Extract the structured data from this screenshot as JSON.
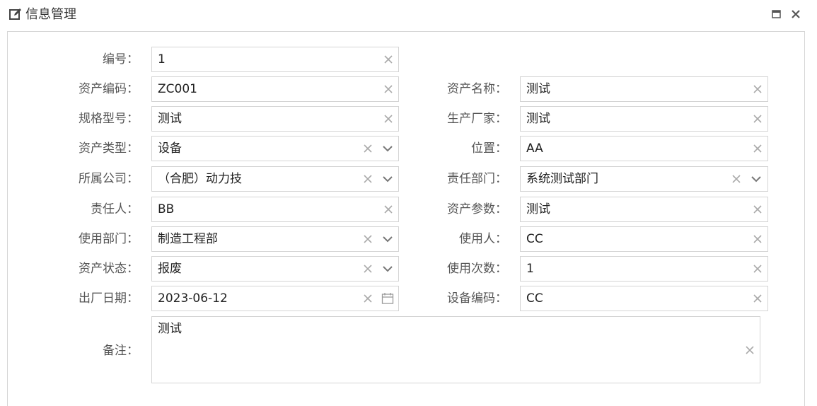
{
  "window": {
    "title": "信息管理",
    "edit_icon": "edit-icon",
    "maximize_icon": "maximize-icon",
    "close_icon": "close-icon"
  },
  "form": {
    "bianhao": {
      "label": "编号：",
      "value": "1"
    },
    "zcbm": {
      "label": "资产编码：",
      "value": "ZC001"
    },
    "zcmc": {
      "label": "资产名称：",
      "value": "测试"
    },
    "ggxh": {
      "label": "规格型号：",
      "value": "测试"
    },
    "sccj": {
      "label": "生产厂家：",
      "value": "测试"
    },
    "zclx": {
      "label": "资产类型：",
      "value": "设备"
    },
    "weizhi": {
      "label": "位置：",
      "value": "AA"
    },
    "ssgs": {
      "label": "所属公司：",
      "value": "（合肥）动力技"
    },
    "zrbm": {
      "label": "责任部门：",
      "value": "系统测试部门"
    },
    "zrr": {
      "label": "责任人：",
      "value": "BB"
    },
    "zccs": {
      "label": "资产参数：",
      "value": "测试"
    },
    "sybm": {
      "label": "使用部门：",
      "value": "制造工程部"
    },
    "syr": {
      "label": "使用人：",
      "value": "CC"
    },
    "zczt": {
      "label": "资产状态：",
      "value": "报废"
    },
    "sycs": {
      "label": "使用次数：",
      "value": "1"
    },
    "ccrq": {
      "label": "出厂日期：",
      "value": "2023-06-12"
    },
    "sbbm": {
      "label": "设备编码：",
      "value": "CC"
    },
    "beizhu": {
      "label": "备注：",
      "value": "测试"
    }
  },
  "icons": {
    "clear": "clear-icon",
    "dropdown": "chevron-down-icon",
    "calendar": "calendar-icon"
  },
  "colors": {
    "border": "#d4d4d4",
    "icon": "#999999",
    "label": "#555555"
  }
}
